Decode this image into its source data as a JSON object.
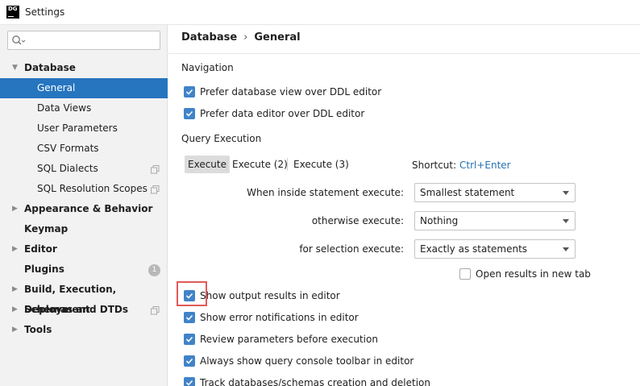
{
  "window": {
    "title": "Settings",
    "logo_text_1": "DG",
    "logo_text_2": ""
  },
  "sidebar": {
    "search_placeholder": "",
    "items": [
      {
        "label": "Database",
        "level": 0,
        "expanded": true
      },
      {
        "label": "General",
        "level": 1,
        "selected": true
      },
      {
        "label": "Data Views",
        "level": 1
      },
      {
        "label": "User Parameters",
        "level": 1
      },
      {
        "label": "CSV Formats",
        "level": 1
      },
      {
        "label": "SQL Dialects",
        "level": 1,
        "icon": "copy-icon"
      },
      {
        "label": "SQL Resolution Scopes",
        "level": 1,
        "icon": "copy-icon"
      },
      {
        "label": "Appearance & Behavior",
        "level": 0,
        "collapsed": true
      },
      {
        "label": "Keymap",
        "level": 0
      },
      {
        "label": "Editor",
        "level": 0,
        "collapsed": true
      },
      {
        "label": "Plugins",
        "level": 0,
        "badge": "1"
      },
      {
        "label": "Build, Execution, Deployment",
        "level": 0,
        "collapsed": true
      },
      {
        "label": "Schemas and DTDs",
        "level": 0,
        "collapsed": true,
        "icon": "copy-icon"
      },
      {
        "label": "Tools",
        "level": 0,
        "collapsed": true
      }
    ]
  },
  "breadcrumb": {
    "parent": "Database",
    "sep": "›",
    "current": "General"
  },
  "navigation": {
    "title": "Navigation",
    "options": [
      {
        "label": "Prefer database view over DDL editor",
        "checked": true
      },
      {
        "label": "Prefer data editor over DDL editor",
        "checked": true
      }
    ]
  },
  "query_execution": {
    "title": "Query Execution",
    "tabs": [
      "Execute",
      "Execute (2)",
      "Execute (3)"
    ],
    "active_tab": "Execute",
    "shortcut_label": "Shortcut:",
    "shortcut_value": "Ctrl+Enter",
    "fields": [
      {
        "label": "When inside statement execute:",
        "value": "Smallest statement"
      },
      {
        "label": "otherwise execute:",
        "value": "Nothing"
      },
      {
        "label": "for selection execute:",
        "value": "Exactly as statements"
      }
    ],
    "open_new_tab": {
      "label": "Open results in new tab",
      "checked": false
    },
    "options": [
      {
        "label": "Show output results in editor",
        "checked": true
      },
      {
        "label": "Show error notifications in editor",
        "checked": true
      },
      {
        "label": "Review parameters before execution",
        "checked": true
      },
      {
        "label": "Always show query console toolbar in editor",
        "checked": true
      },
      {
        "label": "Track databases/schemas creation and deletion",
        "checked": true
      }
    ]
  },
  "colors": {
    "accent": "#2675bf",
    "checkbox": "#4083c9",
    "link": "#2470b3",
    "highlight": "#e05a5a"
  }
}
